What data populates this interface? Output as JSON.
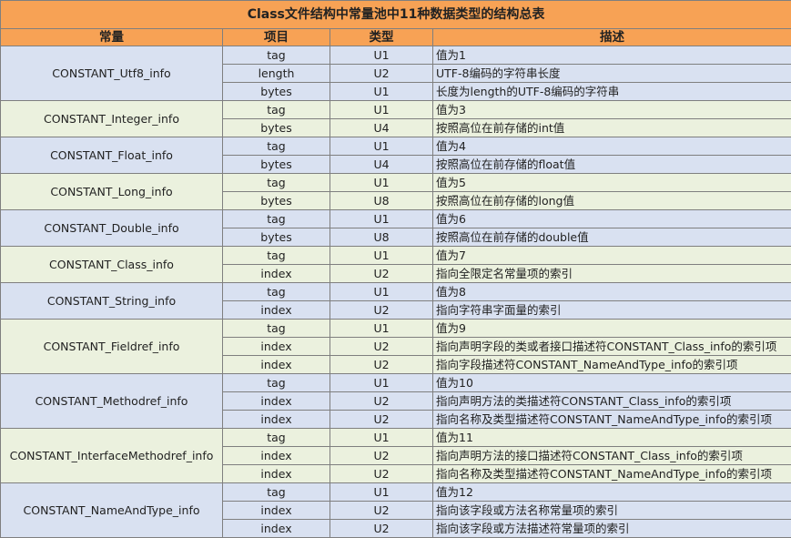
{
  "title": "Class文件结构中常量池中11种数据类型的结构总表",
  "headers": [
    "常量",
    "项目",
    "类型",
    "描述"
  ],
  "groups": [
    {
      "constant": "CONSTANT_Utf8_info",
      "rows": [
        {
          "item": "tag",
          "type": "U1",
          "desc": "值为1"
        },
        {
          "item": "length",
          "type": "U2",
          "desc": "UTF-8编码的字符串长度"
        },
        {
          "item": "bytes",
          "type": "U1",
          "desc": "长度为length的UTF-8编码的字符串"
        }
      ]
    },
    {
      "constant": "CONSTANT_Integer_info",
      "rows": [
        {
          "item": "tag",
          "type": "U1",
          "desc": "值为3"
        },
        {
          "item": "bytes",
          "type": "U4",
          "desc": "按照高位在前存储的int值"
        }
      ]
    },
    {
      "constant": "CONSTANT_Float_info",
      "rows": [
        {
          "item": "tag",
          "type": "U1",
          "desc": "值为4"
        },
        {
          "item": "bytes",
          "type": "U4",
          "desc": "按照高位在前存储的float值"
        }
      ]
    },
    {
      "constant": "CONSTANT_Long_info",
      "rows": [
        {
          "item": "tag",
          "type": "U1",
          "desc": "值为5"
        },
        {
          "item": "bytes",
          "type": "U8",
          "desc": "按照高位在前存储的long值"
        }
      ]
    },
    {
      "constant": "CONSTANT_Double_info",
      "rows": [
        {
          "item": "tag",
          "type": "U1",
          "desc": "值为6"
        },
        {
          "item": "bytes",
          "type": "U8",
          "desc": "按照高位在前存储的double值"
        }
      ]
    },
    {
      "constant": "CONSTANT_Class_info",
      "rows": [
        {
          "item": "tag",
          "type": "U1",
          "desc": "值为7"
        },
        {
          "item": "index",
          "type": "U2",
          "desc": "指向全限定名常量项的索引"
        }
      ]
    },
    {
      "constant": "CONSTANT_String_info",
      "rows": [
        {
          "item": "tag",
          "type": "U1",
          "desc": "值为8"
        },
        {
          "item": "index",
          "type": "U2",
          "desc": "指向字符串字面量的索引"
        }
      ]
    },
    {
      "constant": "CONSTANT_Fieldref_info",
      "rows": [
        {
          "item": "tag",
          "type": "U1",
          "desc": "值为9"
        },
        {
          "item": "index",
          "type": "U2",
          "desc": "指向声明字段的类或者接口描述符CONSTANT_Class_info的索引项"
        },
        {
          "item": "index",
          "type": "U2",
          "desc": "指向字段描述符CONSTANT_NameAndType_info的索引项"
        }
      ]
    },
    {
      "constant": "CONSTANT_Methodref_info",
      "rows": [
        {
          "item": "tag",
          "type": "U1",
          "desc": "值为10"
        },
        {
          "item": "index",
          "type": "U2",
          "desc": "指向声明方法的类描述符CONSTANT_Class_info的索引项"
        },
        {
          "item": "index",
          "type": "U2",
          "desc": "指向名称及类型描述符CONSTANT_NameAndType_info的索引项"
        }
      ]
    },
    {
      "constant": "CONSTANT_InterfaceMethodref_info",
      "rows": [
        {
          "item": "tag",
          "type": "U1",
          "desc": "值为11"
        },
        {
          "item": "index",
          "type": "U2",
          "desc": "指向声明方法的接口描述符CONSTANT_Class_info的索引项"
        },
        {
          "item": "index",
          "type": "U2",
          "desc": "指向名称及类型描述符CONSTANT_NameAndType_info的索引项"
        }
      ]
    },
    {
      "constant": "CONSTANT_NameAndType_info",
      "rows": [
        {
          "item": "tag",
          "type": "U1",
          "desc": "值为12"
        },
        {
          "item": "index",
          "type": "U2",
          "desc": "指向该字段或方法名称常量项的索引"
        },
        {
          "item": "index",
          "type": "U2",
          "desc": "指向该字段或方法描述符常量项的索引"
        }
      ]
    }
  ],
  "colors": {
    "header_bg": "#f7a255",
    "band_blue": "#d9e1f1",
    "band_green": "#ebf1de",
    "border": "#7f7f7f"
  }
}
